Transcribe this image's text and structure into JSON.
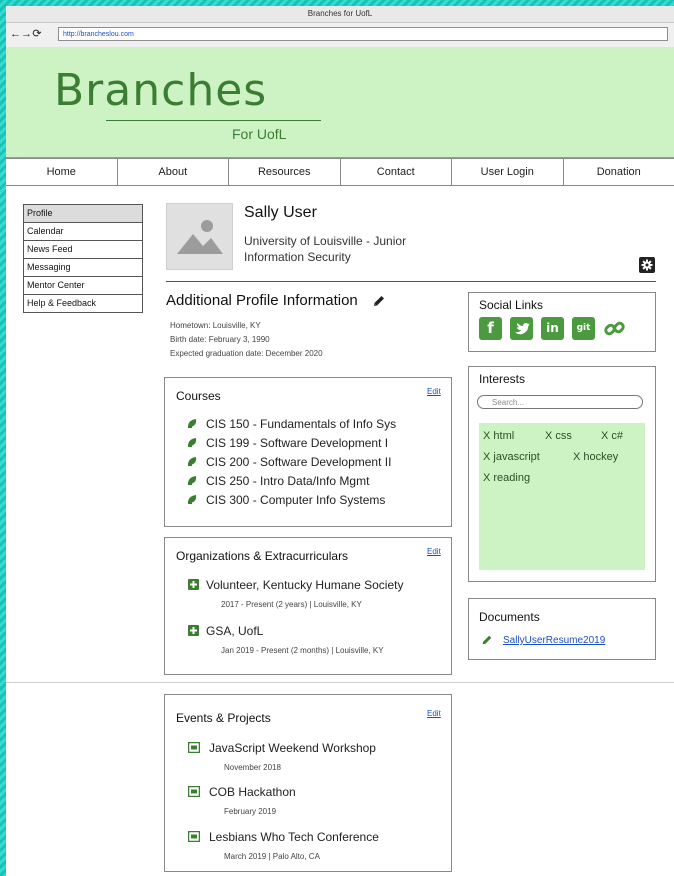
{
  "window": {
    "title": "Branches for UofL"
  },
  "browser": {
    "url": "http://brancheslou.com"
  },
  "brand": {
    "name": "Branches",
    "subtitle": "For UofL",
    "color": "#3b7d32",
    "banner_color": "#cdf3c4"
  },
  "nav": {
    "items": [
      "Home",
      "About",
      "Resources",
      "Contact",
      "User Login",
      "Donation"
    ]
  },
  "sidebar": {
    "items": [
      "Profile",
      "Calendar",
      "News Feed",
      "Messaging",
      "Mentor Center",
      "Help & Feedback"
    ],
    "active": "Profile"
  },
  "profile": {
    "name": "Sally User",
    "university": "University of Louisville - Junior",
    "major": "Information Security",
    "additional_title": "Additional Profile Information",
    "hometown_label": "Hometown:",
    "hometown": "Louisville, KY",
    "birth_label": "Birth date:",
    "birth": "February 3, 1990",
    "grad_label": "Expected graduation date:",
    "grad": "December 2020"
  },
  "courses": {
    "title": "Courses",
    "edit": "Edit",
    "items": [
      "CIS 150 - Fundamentals of Info Sys",
      "CIS 199 - Software Development I",
      "CIS 200 - Software Development II",
      "CIS 250 - Intro Data/Info Mgmt",
      "CIS 300 - Computer Info Systems"
    ]
  },
  "orgs": {
    "title": "Organizations & Extracurriculars",
    "edit": "Edit",
    "items": [
      {
        "name": "Volunteer, Kentucky Humane Society",
        "detail": "2017 - Present (2 years) | Louisville, KY"
      },
      {
        "name": "GSA, UofL",
        "detail": "Jan 2019 - Present (2 months) | Louisville, KY"
      }
    ]
  },
  "events": {
    "title": "Events & Projects",
    "edit": "Edit",
    "items": [
      {
        "name": "JavaScript Weekend Workshop",
        "detail": "November 2018"
      },
      {
        "name": "COB Hackathon",
        "detail": "February 2019"
      },
      {
        "name": "Lesbians Who Tech Conference",
        "detail": "March 2019 | Palo Alto, CA"
      }
    ]
  },
  "social": {
    "title": "Social Links",
    "icons": [
      "f",
      "t",
      "in",
      "git",
      "link"
    ]
  },
  "interests": {
    "title": "Interests",
    "search_placeholder": "Search...",
    "tags": [
      "X html",
      "X css",
      "X c#",
      "X javascript",
      "X hockey",
      "X reading"
    ]
  },
  "documents": {
    "title": "Documents",
    "items": [
      "SallyUserResume2019"
    ]
  }
}
